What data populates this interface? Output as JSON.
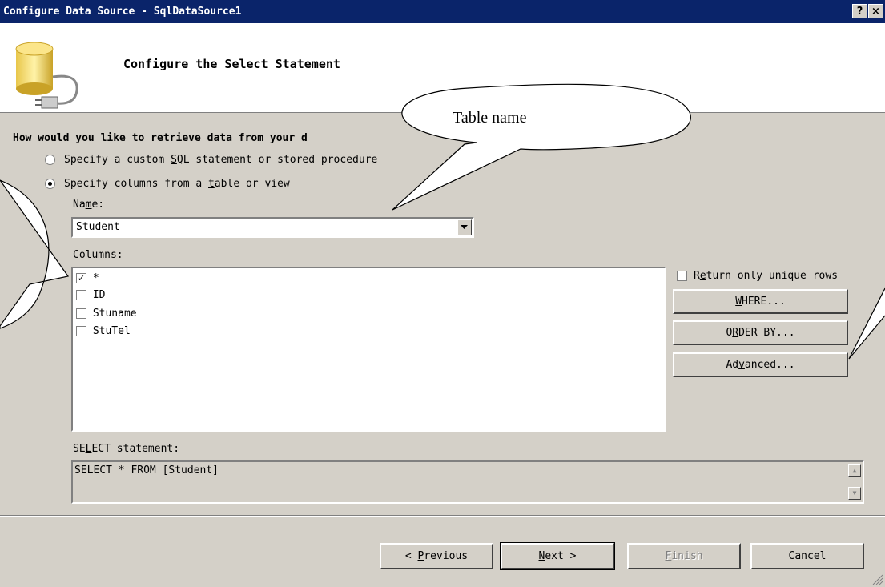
{
  "window": {
    "title": "Configure Data Source - SqlDataSource1",
    "help_btn": "?",
    "close_btn": "×"
  },
  "header": {
    "title": "Configure the Select Statement",
    "icon": "database-plug-icon"
  },
  "question": "How would you like to retrieve data from your d",
  "options": {
    "custom_sql": {
      "pre": "Specify a custom ",
      "ul": "S",
      "post": "QL statement or stored procedure",
      "selected": false
    },
    "columns_from_table": {
      "pre": "Specify columns from a ",
      "ul": "t",
      "post": "able or view",
      "selected": true
    }
  },
  "name_field": {
    "label_pre": "Na",
    "label_ul": "m",
    "label_post": "e:",
    "value": "Student"
  },
  "columns": {
    "label_pre": "C",
    "label_ul": "o",
    "label_post": "lumns:",
    "items": [
      {
        "label": "*",
        "checked": true
      },
      {
        "label": "ID",
        "checked": false
      },
      {
        "label": "Stuname",
        "checked": false
      },
      {
        "label": "StuTel",
        "checked": false
      }
    ]
  },
  "unique_rows": {
    "pre": "R",
    "ul": "e",
    "post": "turn only unique rows",
    "checked": false
  },
  "side_buttons": {
    "where": {
      "ul": "W",
      "post": "HERE..."
    },
    "order_by": {
      "pre": "O",
      "ul": "R",
      "post": "DER BY..."
    },
    "advanced": {
      "pre": "Ad",
      "ul": "v",
      "post": "anced..."
    }
  },
  "select_statement": {
    "label_pre": "SE",
    "label_ul": "L",
    "label_post": "ECT statement:",
    "value": "SELECT * FROM [Student]"
  },
  "footer": {
    "previous": {
      "pre": "< ",
      "ul": "P",
      "post": "revious"
    },
    "next": {
      "ul": "N",
      "post": "ext >"
    },
    "finish": {
      "ul": "F",
      "post": "inish"
    },
    "cancel": "Cancel"
  },
  "annotation": {
    "table_name": "Table name"
  }
}
